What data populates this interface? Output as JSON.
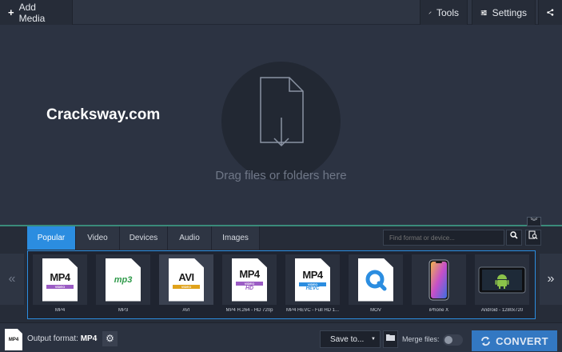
{
  "toolbar": {
    "add_media": "Add Media",
    "tools": "Tools",
    "settings": "Settings"
  },
  "dropzone": {
    "watermark": "Cracksway.com",
    "hint": "Drag files or folders here"
  },
  "tabs": [
    {
      "label": "Popular",
      "active": true
    },
    {
      "label": "Video",
      "active": false
    },
    {
      "label": "Devices",
      "active": false
    },
    {
      "label": "Audio",
      "active": false
    },
    {
      "label": "Images",
      "active": false
    }
  ],
  "search": {
    "placeholder": "Find format or device..."
  },
  "formats": [
    {
      "label": "MP4",
      "icon": "mp4-icon"
    },
    {
      "label": "MP3",
      "icon": "mp3-icon"
    },
    {
      "label": "AVI",
      "icon": "avi-icon",
      "selected": true
    },
    {
      "label": "MP4 H.264 - HD 720p",
      "icon": "mp4-hd-icon"
    },
    {
      "label": "MP4 HEVC - Full HD 1...",
      "icon": "mp4-hevc-icon"
    },
    {
      "label": "MOV",
      "icon": "quicktime-icon"
    },
    {
      "label": "iPhone X",
      "icon": "iphone-icon"
    },
    {
      "label": "Android - 1280x720",
      "icon": "android-icon"
    }
  ],
  "format_icons": {
    "mp4_text": "MP4",
    "mp4_stripe": "VIDEO",
    "mp3_text": "mp3",
    "avi_text": "AVI",
    "avi_stripe": "VIDEO",
    "hd_text": "HD",
    "hevc_text": "HEVC"
  },
  "bottom": {
    "output_label": "Output format:",
    "output_value": "MP4",
    "output_icon_text": "MP4",
    "save_to": "Save to...",
    "merge_label": "Merge files:",
    "merge_on": false,
    "convert": "CONVERT"
  },
  "colors": {
    "accent": "#2b8de0",
    "convert": "#3378c2",
    "divider": "#3a8b7a",
    "background": "#2c3342"
  }
}
